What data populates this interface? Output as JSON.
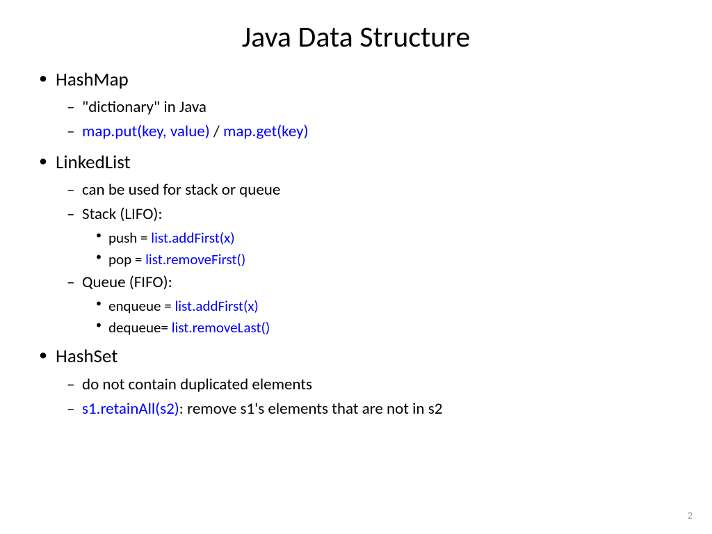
{
  "title": "Java Data Structure",
  "sections": [
    {
      "heading": "HashMap",
      "items": [
        {
          "plain": "\"dictionary\" in Java"
        },
        {
          "code1": "map.put(key, value)",
          "sep": " /  ",
          "code2": "map.get(key)"
        }
      ]
    },
    {
      "heading": "LinkedList",
      "items": [
        {
          "plain": "can be used for stack or queue"
        },
        {
          "plain": "Stack (LIFO):",
          "sub": [
            {
              "prefix": "push = ",
              "code": "list.addFirst(x)"
            },
            {
              "prefix": "pop =  ",
              "code": "list.removeFirst()"
            }
          ]
        },
        {
          "plain": "Queue (FIFO):",
          "sub": [
            {
              "prefix": "enqueue = ",
              "code": "list.addFirst(x)"
            },
            {
              "prefix": "dequeue= ",
              "code": "list.removeLast()"
            }
          ]
        }
      ]
    },
    {
      "heading": "HashSet",
      "items": [
        {
          "plain": "do not contain duplicated elements"
        },
        {
          "code1": "s1.retainAll(s2)",
          "suffix": ": remove s1's elements that are not in s2"
        }
      ]
    }
  ],
  "page_number": "2"
}
